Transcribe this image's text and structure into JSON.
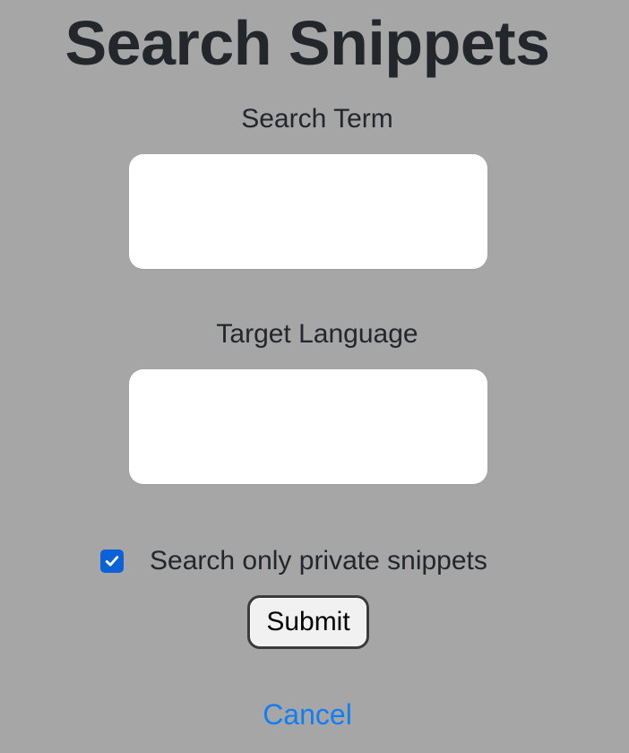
{
  "page": {
    "title": "Search Snippets"
  },
  "form": {
    "search_term": {
      "label": "Search Term",
      "value": ""
    },
    "target_language": {
      "label": "Target Language",
      "value": ""
    },
    "private_only": {
      "label": "Search only private snippets",
      "checked": true
    },
    "submit_label": "Submit",
    "cancel_label": "Cancel"
  },
  "colors": {
    "background": "#a6a6a6",
    "checkbox_accent": "#0a62d6",
    "link": "#127ef4"
  },
  "icons": {
    "checkbox": "checkmark-icon"
  }
}
